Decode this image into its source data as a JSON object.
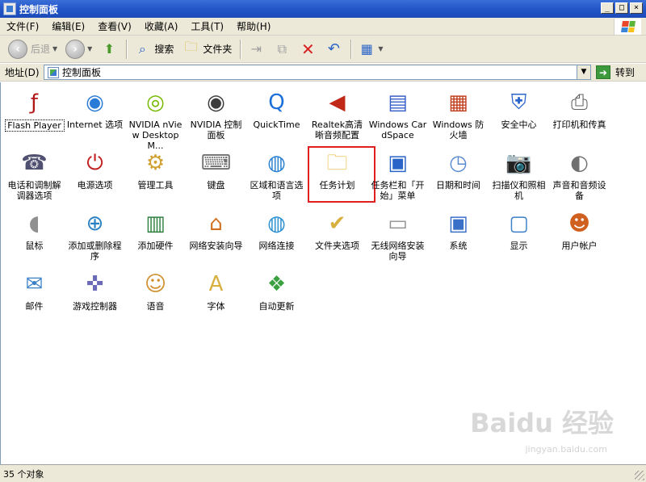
{
  "window": {
    "title": "控制面板"
  },
  "window_buttons": [
    "_",
    "□",
    "×"
  ],
  "menu": [
    "文件(F)",
    "编辑(E)",
    "查看(V)",
    "收藏(A)",
    "工具(T)",
    "帮助(H)"
  ],
  "toolbar": {
    "back": "后退",
    "search": "搜索",
    "folders": "文件夹"
  },
  "address": {
    "label": "地址(D)",
    "value": "控制面板",
    "go": "转到"
  },
  "items": [
    {
      "label": "Flash Player",
      "icon": "flash-icon",
      "glyph": "ƒ",
      "color": "#b01818"
    },
    {
      "label": "Internet 选项",
      "icon": "internet-options-icon",
      "glyph": "◉",
      "color": "#2a7ad8"
    },
    {
      "label": "NVIDIA nView Desktop M...",
      "icon": "nvidia-nview-icon",
      "glyph": "◎",
      "color": "#76b900"
    },
    {
      "label": "NVIDIA 控制面板",
      "icon": "nvidia-control-icon",
      "glyph": "◉",
      "color": "#3c3c3c"
    },
    {
      "label": "QuickTime",
      "icon": "quicktime-icon",
      "glyph": "Q",
      "color": "#1a70d8"
    },
    {
      "label": "Realtek高清晰音频配置",
      "icon": "speaker-icon",
      "glyph": "◀",
      "color": "#c02818"
    },
    {
      "label": "Windows CardSpace",
      "icon": "cardspace-icon",
      "glyph": "▤",
      "color": "#3a5fc8"
    },
    {
      "label": "Windows 防火墙",
      "icon": "firewall-icon",
      "glyph": "▦",
      "color": "#c04020"
    },
    {
      "label": "安全中心",
      "icon": "security-center-icon",
      "glyph": "⛨",
      "color": "#2a64c8"
    },
    {
      "label": "打印机和传真",
      "icon": "printer-icon",
      "glyph": "⎙",
      "color": "#606060"
    },
    {
      "label": "电话和调制解调器选项",
      "icon": "phone-modem-icon",
      "glyph": "☎",
      "color": "#505070"
    },
    {
      "label": "电源选项",
      "icon": "power-icon",
      "glyph": "⏻",
      "color": "#c02020"
    },
    {
      "label": "管理工具",
      "icon": "admin-tools-icon",
      "glyph": "⚙",
      "color": "#d0a030"
    },
    {
      "label": "键盘",
      "icon": "keyboard-icon",
      "glyph": "⌨",
      "color": "#707070"
    },
    {
      "label": "区域和语言选项",
      "icon": "globe-icon",
      "glyph": "◍",
      "color": "#2a80d0"
    },
    {
      "label": "任务计划",
      "icon": "scheduled-tasks-icon",
      "glyph": "🗀",
      "color": "#e8b838"
    },
    {
      "label": "任务栏和「开始」菜单",
      "icon": "taskbar-icon",
      "glyph": "▣",
      "color": "#2a64c8"
    },
    {
      "label": "日期和时间",
      "icon": "clock-icon",
      "glyph": "◷",
      "color": "#5a8ad0"
    },
    {
      "label": "扫描仪和照相机",
      "icon": "scanner-camera-icon",
      "glyph": "📷",
      "color": "#808080"
    },
    {
      "label": "声音和音频设备",
      "icon": "sound-icon",
      "glyph": "◐",
      "color": "#707070"
    },
    {
      "label": "鼠标",
      "icon": "mouse-icon",
      "glyph": "◖",
      "color": "#909090"
    },
    {
      "label": "添加或删除程序",
      "icon": "add-remove-icon",
      "glyph": "⊕",
      "color": "#2a80c0"
    },
    {
      "label": "添加硬件",
      "icon": "add-hardware-icon",
      "glyph": "▥",
      "color": "#308040"
    },
    {
      "label": "网络安装向导",
      "icon": "network-wizard-icon",
      "glyph": "⌂",
      "color": "#d07020"
    },
    {
      "label": "网络连接",
      "icon": "network-connections-icon",
      "glyph": "◍",
      "color": "#2a90d0"
    },
    {
      "label": "文件夹选项",
      "icon": "folder-options-icon",
      "glyph": "✔",
      "color": "#d8b040"
    },
    {
      "label": "无线网络安装向导",
      "icon": "wireless-icon",
      "glyph": "▭",
      "color": "#909090"
    },
    {
      "label": "系统",
      "icon": "system-icon",
      "glyph": "▣",
      "color": "#3a70c8"
    },
    {
      "label": "显示",
      "icon": "display-icon",
      "glyph": "▢",
      "color": "#3a80c8"
    },
    {
      "label": "用户帐户",
      "icon": "user-accounts-icon",
      "glyph": "☻",
      "color": "#d06020"
    },
    {
      "label": "邮件",
      "icon": "mail-icon",
      "glyph": "✉",
      "color": "#3a80c8"
    },
    {
      "label": "游戏控制器",
      "icon": "game-controller-icon",
      "glyph": "✜",
      "color": "#6a6ab8"
    },
    {
      "label": "语音",
      "icon": "speech-icon",
      "glyph": "☺",
      "color": "#d09030"
    },
    {
      "label": "字体",
      "icon": "fonts-icon",
      "glyph": "A",
      "color": "#d8b040"
    },
    {
      "label": "自动更新",
      "icon": "auto-update-icon",
      "glyph": "❖",
      "color": "#3aa040"
    }
  ],
  "selected_item": "任务计划",
  "status": {
    "text": "35 个对象"
  },
  "watermark": {
    "brand": "Baidu 经验",
    "url": "jingyan.baidu.com"
  },
  "colors": {
    "titlebar": "#2356c8",
    "chrome": "#ece9d8",
    "selection_outline": "#e02020"
  }
}
